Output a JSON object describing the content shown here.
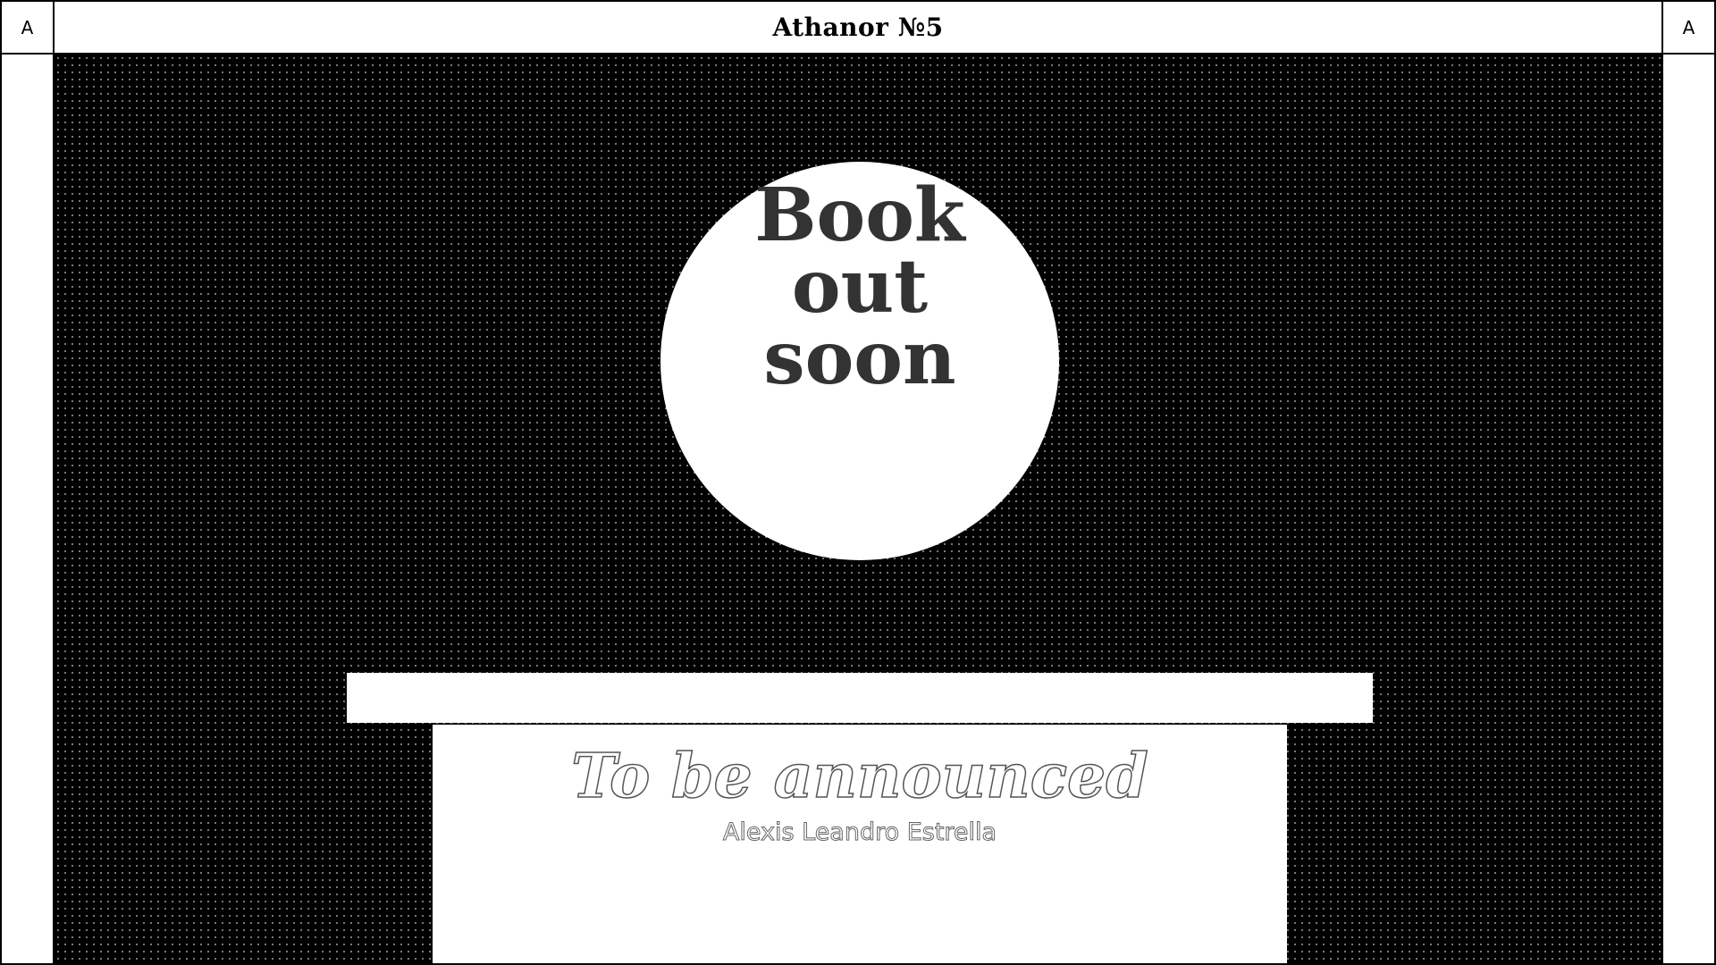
{
  "header": {
    "title": "Athanor №5",
    "left_corner_label": "A",
    "right_corner_label": "A"
  },
  "hero": {
    "circle_lines": [
      "Book",
      "out",
      "soon"
    ]
  },
  "card": {
    "title": "To be announced",
    "author": "Alexis Leandro Estrella"
  },
  "colors": {
    "background": "#000000",
    "surface": "#ffffff",
    "circle_text": "#333333",
    "outline_text": "#555555"
  }
}
